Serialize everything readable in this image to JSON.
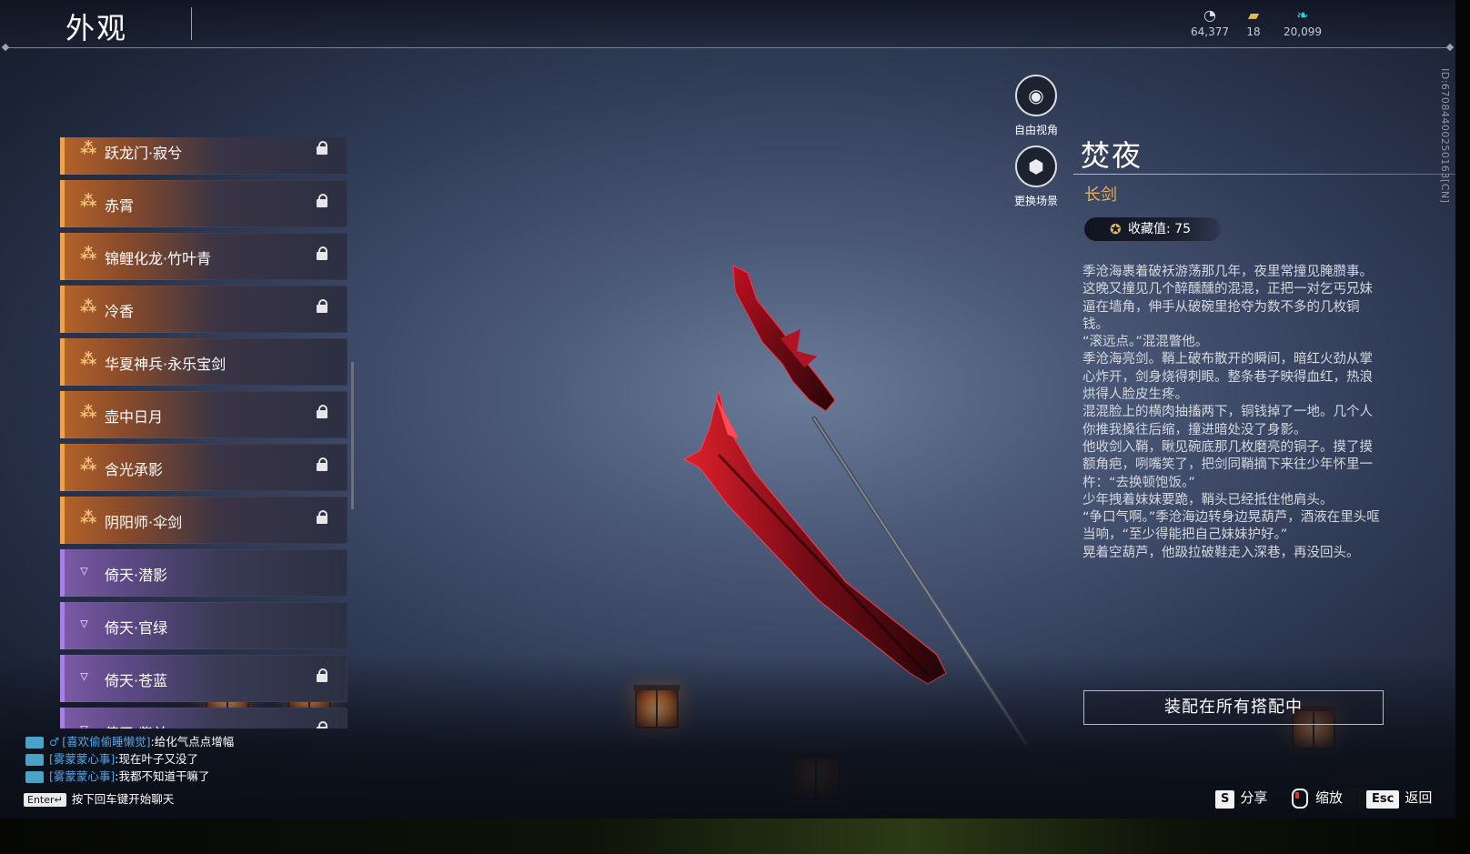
{
  "header": {
    "title": "外观",
    "currencies": [
      {
        "icon": "coin-icon",
        "value": "64,377"
      },
      {
        "icon": "ticket-icon",
        "value": "18"
      },
      {
        "icon": "feather-icon",
        "value": "20,099"
      }
    ]
  },
  "session_id": "ID:67084400250163[CN]",
  "tools": [
    {
      "label": "自由视角",
      "icon": "camera-icon"
    },
    {
      "label": "更换场景",
      "icon": "scene-icon"
    }
  ],
  "list": {
    "items": [
      {
        "label": "跃龙门·寂兮",
        "rarity": "orange",
        "locked": true
      },
      {
        "label": "赤霄",
        "rarity": "orange",
        "locked": true
      },
      {
        "label": "锦鲤化龙·竹叶青",
        "rarity": "orange",
        "locked": true
      },
      {
        "label": "冷香",
        "rarity": "orange",
        "locked": true
      },
      {
        "label": "华夏神兵·永乐宝剑",
        "rarity": "orange",
        "locked": false
      },
      {
        "label": "壶中日月",
        "rarity": "orange",
        "locked": true
      },
      {
        "label": "含光承影",
        "rarity": "orange",
        "locked": true
      },
      {
        "label": "阴阳师·伞剑",
        "rarity": "orange",
        "locked": true
      },
      {
        "label": "倚天·潜影",
        "rarity": "purple",
        "locked": false
      },
      {
        "label": "倚天·官绿",
        "rarity": "purple",
        "locked": false
      },
      {
        "label": "倚天·苍蓝",
        "rarity": "purple",
        "locked": true
      },
      {
        "label": "倚天·紫兰",
        "rarity": "purple",
        "locked": true
      }
    ]
  },
  "detail": {
    "name": "焚夜",
    "type": "长剑",
    "collect_label": "收藏值: 75",
    "description": [
      "季沧海裹着破袄游荡那几年，夜里常撞见腌臜事。这晚又撞见几个醉醺醺的混混，正把一对乞丐兄妹逼在墙角，伸手从破碗里抢夺为数不多的几枚铜钱。",
      "“滚远点。”混混瞥他。",
      "季沧海亮剑。鞘上破布散开的瞬间，暗红火劲从掌心炸开，剑身烧得刺眼。整条巷子映得血红，热浪烘得人脸皮生疼。",
      "混混脸上的横肉抽搐两下，铜钱掉了一地。几个人你推我搡往后缩，撞进暗处没了身影。",
      "他收剑入鞘，瞅见碗底那几枚磨亮的铜子。摸了摸额角疤，咧嘴笑了，把剑同鞘摘下来往少年怀里一杵：“去换顿饱饭。”",
      "少年拽着妹妹要跪，鞘头已经抵住他肩头。",
      "“争口气啊。”季沧海边转身边晃葫芦，酒液在里头哐当响，“至少得能把自己妹妹护好。”",
      "晃着空葫芦，他趿拉破鞋走入深巷，再没回头。"
    ],
    "equip_button": "装配在所有搭配中"
  },
  "chat": {
    "messages": [
      {
        "name": "[喜欢偷偷睡懒觉]",
        "text": ":给化气点点增幅",
        "gender": "♂"
      },
      {
        "name": "[雾蒙蒙心事]",
        "text": ":现在叶子又没了",
        "gender": ""
      },
      {
        "name": "[雾蒙蒙心事]",
        "text": ":我都不知道干嘛了",
        "gender": ""
      }
    ],
    "enter_key": "Enter↵",
    "enter_hint": "按下回车键开始聊天"
  },
  "hints": {
    "share_key": "S",
    "share_label": "分享",
    "zoom_label": "缩放",
    "back_key": "Esc",
    "back_label": "返回"
  },
  "colors": {
    "orange_rarity": "#f0a24a",
    "purple_rarity": "#a97fe6",
    "type_gold": "#e0b060",
    "chat_name_blue": "#56a6e8"
  }
}
